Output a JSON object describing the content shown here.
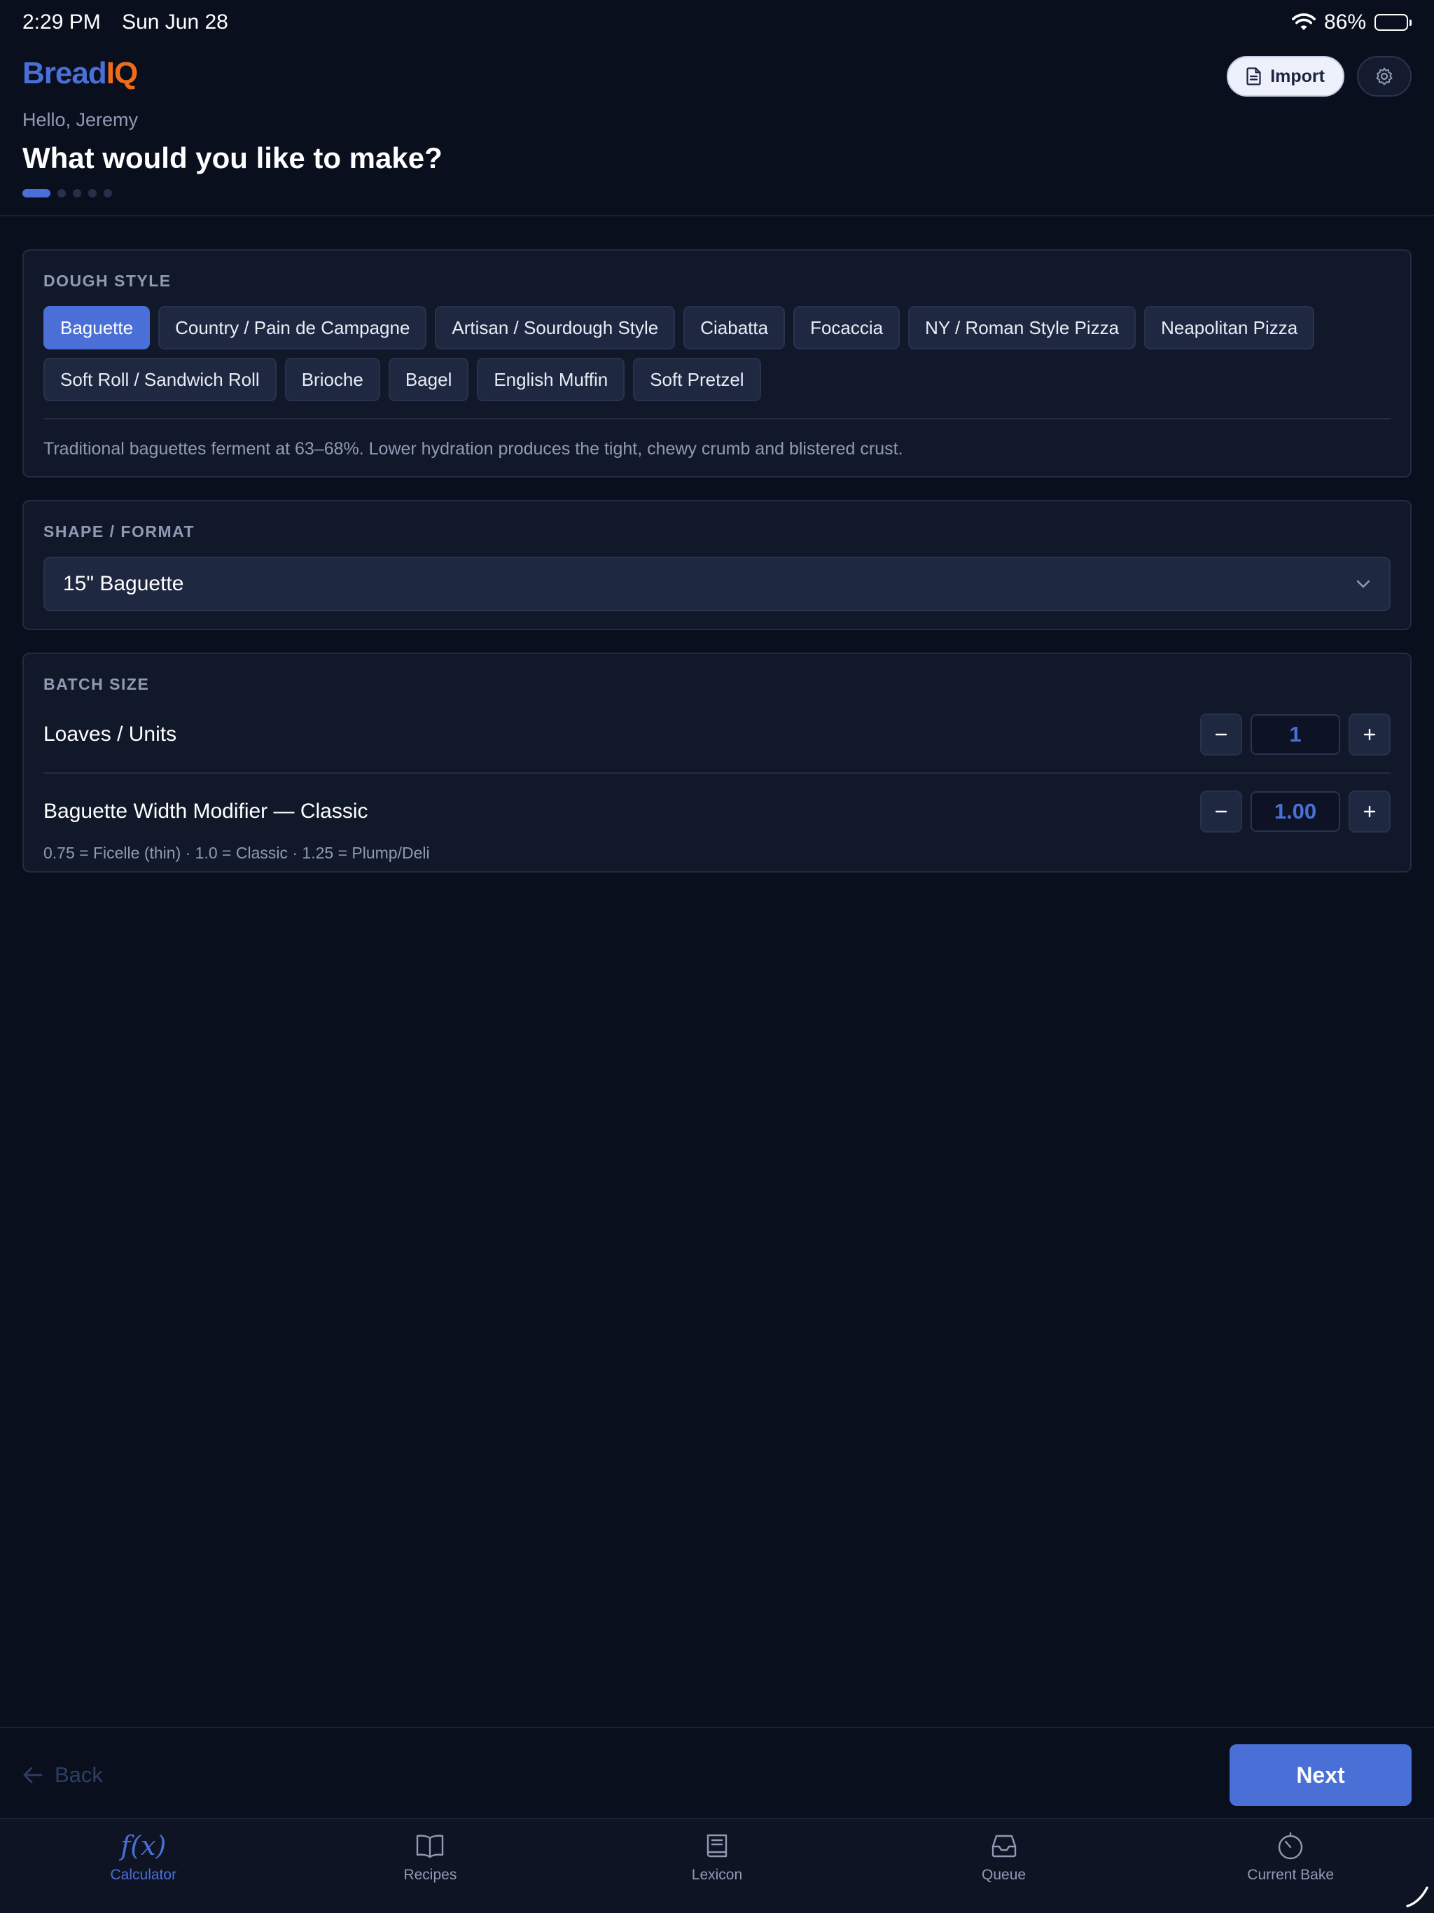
{
  "status": {
    "time": "2:29 PM",
    "date": "Sun Jun 28",
    "battery": "86%"
  },
  "header": {
    "logo_part1": "Bread",
    "logo_part2": "IQ",
    "import_label": "Import",
    "greeting": "Hello, Jeremy",
    "title": "What would you like to make?",
    "progress": {
      "current_step": 1,
      "total_steps": 5
    }
  },
  "dough_style": {
    "label": "DOUGH STYLE",
    "options": [
      "Baguette",
      "Country / Pain de Campagne",
      "Artisan / Sourdough Style",
      "Ciabatta",
      "Focaccia",
      "NY / Roman Style Pizza",
      "Neapolitan Pizza",
      "Soft Roll / Sandwich Roll",
      "Brioche",
      "Bagel",
      "English Muffin",
      "Soft Pretzel"
    ],
    "selected": "Baguette",
    "description": "Traditional baguettes ferment at 63–68%. Lower hydration produces the tight, chewy crumb and blistered crust."
  },
  "shape": {
    "label": "SHAPE / FORMAT",
    "selected": "15\" Baguette"
  },
  "batch": {
    "label": "BATCH SIZE",
    "loaves_label": "Loaves / Units",
    "loaves_value": "1",
    "width_label": "Baguette Width Modifier — Classic",
    "width_value": "1.00",
    "width_hint": "0.75 = Ficelle (thin) · 1.0 = Classic · 1.25 = Plump/Deli"
  },
  "footer": {
    "back_label": "Back",
    "next_label": "Next"
  },
  "tabs": [
    {
      "id": "calculator",
      "label": "Calculator",
      "icon": "function-icon",
      "active": true
    },
    {
      "id": "recipes",
      "label": "Recipes",
      "icon": "book-open-icon",
      "active": false
    },
    {
      "id": "lexicon",
      "label": "Lexicon",
      "icon": "book-icon",
      "active": false
    },
    {
      "id": "queue",
      "label": "Queue",
      "icon": "inbox-icon",
      "active": false
    },
    {
      "id": "current-bake",
      "label": "Current Bake",
      "icon": "timer-icon",
      "active": false
    }
  ],
  "colors": {
    "background": "#0a0f1e",
    "accent": "#4a6fd6",
    "brand_orange": "#ef6c1a",
    "muted_text": "#8f9bb4"
  }
}
